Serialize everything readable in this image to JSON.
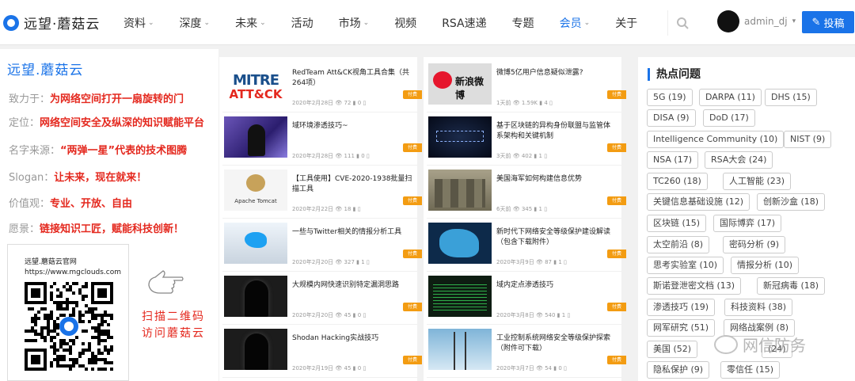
{
  "header": {
    "logo_text": "远望·蘑菇云",
    "nav": [
      {
        "label": "资料",
        "dropdown": true
      },
      {
        "label": "深度",
        "dropdown": true
      },
      {
        "label": "未来",
        "dropdown": true
      },
      {
        "label": "活动",
        "dropdown": false
      },
      {
        "label": "市场",
        "dropdown": true
      },
      {
        "label": "视频",
        "dropdown": false
      },
      {
        "label": "RSA速递",
        "dropdown": false
      },
      {
        "label": "专题",
        "dropdown": false
      },
      {
        "label": "会员",
        "dropdown": true,
        "active": true
      },
      {
        "label": "关于",
        "dropdown": false
      }
    ],
    "username": "admin_dj",
    "post_label": "投稿",
    "accent": "#1a73e8"
  },
  "left": {
    "title": "远望.蘑菇云",
    "rows": [
      {
        "k": "致力于：",
        "v": "为网络空间打开一扇旋转的门"
      },
      {
        "k": "定位：",
        "v": "网络空间安全及纵深的知识赋能平台"
      },
      {
        "k": "名字来源：",
        "v": "“两弹一星”代表的技术图腾"
      },
      {
        "k": "Slogan：",
        "v": "让未来，现在就来！"
      },
      {
        "k": "价值观：",
        "v": "专业、开放、自由"
      },
      {
        "k": "愿景：",
        "v": "链接知识工匠，赋能科技创新！"
      }
    ],
    "qr_line1": "远望.蘑菇云官网",
    "qr_line2": "https://www.mgclouds.com",
    "scan_line1": "扫描二维码",
    "scan_line2": "访问蘑菇云",
    "highlight": "#e4281e"
  },
  "col1": [
    {
      "title": "RedTeam Att&CK视角工具合集（共264项）",
      "date": "2020年2月28日",
      "views": "72",
      "likes": "0",
      "thumb": "mitre",
      "thumb_text": "MITRE ATT&CK"
    },
    {
      "title": "域环境渗透技巧~",
      "date": "2020年2月28日",
      "views": "111",
      "likes": "0",
      "thumb": "hacker"
    },
    {
      "title": "【工具使用】CVE-2020-1938批量扫描工具",
      "date": "2020年2月22日",
      "views": "18",
      "likes": "",
      "thumb": "tomcat",
      "thumb_text": "Apache Tomcat"
    },
    {
      "title": "一些与Twitter相关的情报分析工具",
      "date": "2020年2月20日",
      "views": "327",
      "likes": "1",
      "thumb": "twitter"
    },
    {
      "title": "大规模内网快速识别特定漏洞思路",
      "date": "2020年2月20日",
      "views": "45",
      "likes": "0",
      "thumb": "dark"
    },
    {
      "title": "Shodan Hacking实战技巧",
      "date": "2020年2月19日",
      "views": "45",
      "likes": "0",
      "thumb": "hood"
    }
  ],
  "col2": [
    {
      "title": "微博5亿用户信息疑似泄露?",
      "date": "1天前",
      "views": "1.59K",
      "likes": "4",
      "thumb": "weibo",
      "thumb_text": "新浪微博"
    },
    {
      "title": "基于区块链的异构身份联盟与监管体系架构和关键机制",
      "date": "3天前",
      "views": "402",
      "likes": "1",
      "thumb": "chain"
    },
    {
      "title": "美国海军如何构建信息优势",
      "date": "6天前",
      "views": "345",
      "likes": "1",
      "thumb": "soldier"
    },
    {
      "title": "新时代下网络安全等级保护建设解读（包含下载附件）",
      "date": "2020年3月9日",
      "views": "87",
      "likes": "1",
      "thumb": "map"
    },
    {
      "title": "域内定点渗透技巧",
      "date": "2020年3月8日",
      "views": "540",
      "likes": "1",
      "thumb": "code"
    },
    {
      "title": "工业控制系统网络安全等级保护探索（附件可下载）",
      "date": "2020年3月7日",
      "views": "54",
      "likes": "0",
      "thumb": "tower"
    }
  ],
  "paid_label": "付费",
  "hot": {
    "title": "热点问题",
    "tags": [
      "5G (19)",
      "DARPA (11)",
      "DHS (15)",
      "DISA (9)",
      "DoD (17)",
      "Intelligence Community (10)",
      "NIST (9)",
      "NSA (17)",
      "RSA大会 (24)",
      "TC260 (18)",
      "人工智能 (23)",
      "关键信息基础设施 (12)",
      "创新沙盒 (18)",
      "区块链 (15)",
      "国际博弈 (17)",
      "太空前沿 (8)",
      "密码分析 (9)",
      "思考实验室 (10)",
      "情报分析 (10)",
      "斯诺登泄密文档 (13)",
      "新冠病毒 (18)",
      "渗透技巧 (19)",
      "科技资料 (38)",
      "网军研究 (51)",
      "网络战案例 (8)",
      "美国 (52)",
      "(24)",
      "隐私保护 (9)",
      "零信任 (15)"
    ]
  },
  "watermark": "网信防务"
}
